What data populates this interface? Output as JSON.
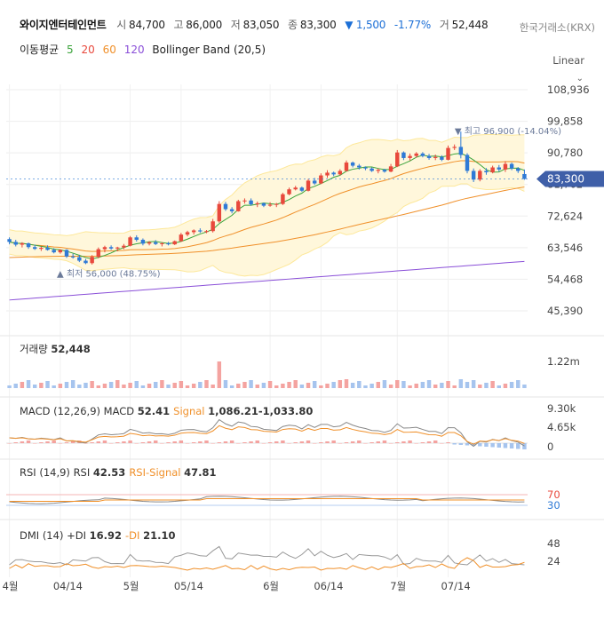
{
  "header": {
    "name": "와이지엔터테인먼트",
    "open_label": "시",
    "open": "84,700",
    "high_label": "고",
    "high": "86,000",
    "low_label": "저",
    "low": "83,050",
    "close_label": "종",
    "close": "83,300",
    "change": "▼ 1,500",
    "change_pct": "-1.77%",
    "volume_label": "거",
    "volume": "52,448",
    "exchange": "한국거래소(KRX)"
  },
  "indicators": {
    "ma_label": "이동평균",
    "ma": [
      {
        "p": "5",
        "color": "#3aa33a"
      },
      {
        "p": "20",
        "color": "#e8483c"
      },
      {
        "p": "60",
        "color": "#f0902a"
      },
      {
        "p": "120",
        "color": "#8a4fd8"
      }
    ],
    "bb_label": "Bollinger Band (20,5)",
    "scale": "Linear"
  },
  "colors": {
    "up": "#e8483c",
    "down": "#2f7ad6",
    "ma5": "#3aa33a",
    "ma20": "#e8483c",
    "ma60": "#f0902a",
    "ma120": "#8a4fd8",
    "bb": "#fde89a",
    "bbfill": "#fff7db"
  },
  "chart_data": {
    "type": "candlestick",
    "x_ticks": [
      "4월",
      "04/14",
      "5월",
      "05/14",
      "6월",
      "06/14",
      "7월",
      "07/14"
    ],
    "y_ticks": [
      108936,
      99858,
      90780,
      81702,
      72624,
      63546,
      54468,
      45390
    ],
    "ylim": [
      45390,
      108936
    ],
    "last_price_label": "83,300",
    "max_annot": "▼ 최고 96,900 (-14.04%)",
    "min_annot": "▲ 최저 56,000 (48.75%)",
    "candles": [
      [
        66000,
        66500,
        64500,
        65200
      ],
      [
        65200,
        65800,
        63900,
        64400
      ],
      [
        64400,
        65100,
        63600,
        64800
      ],
      [
        64800,
        65000,
        63200,
        63700
      ],
      [
        63700,
        64400,
        62900,
        63200
      ],
      [
        63200,
        63900,
        62600,
        63500
      ],
      [
        63500,
        64200,
        62700,
        62900
      ],
      [
        62900,
        63400,
        61900,
        62200
      ],
      [
        62200,
        63100,
        61800,
        62900
      ],
      [
        62900,
        63100,
        60600,
        61000
      ],
      [
        61000,
        61800,
        60400,
        60800
      ],
      [
        60800,
        61500,
        59400,
        59800
      ],
      [
        59800,
        60300,
        58800,
        59100
      ],
      [
        59100,
        61400,
        58700,
        60900
      ],
      [
        60900,
        63600,
        60500,
        63100
      ],
      [
        63100,
        64100,
        62200,
        63700
      ],
      [
        63700,
        64200,
        62900,
        63300
      ],
      [
        63300,
        63800,
        62500,
        63600
      ],
      [
        63600,
        64600,
        63100,
        64100
      ],
      [
        64100,
        66900,
        63900,
        66500
      ],
      [
        66500,
        67100,
        65300,
        65800
      ],
      [
        65800,
        66200,
        64200,
        64700
      ],
      [
        64700,
        65400,
        64200,
        65100
      ],
      [
        65100,
        65700,
        64300,
        64600
      ],
      [
        64600,
        65100,
        63900,
        64800
      ],
      [
        64800,
        65200,
        64200,
        64500
      ],
      [
        64500,
        65600,
        64300,
        65400
      ],
      [
        65400,
        67800,
        65200,
        67300
      ],
      [
        67300,
        68400,
        66800,
        68000
      ],
      [
        68000,
        68800,
        67300,
        68500
      ],
      [
        68500,
        69100,
        67800,
        68200
      ],
      [
        68200,
        68600,
        67700,
        68300
      ],
      [
        68300,
        71800,
        67900,
        71100
      ],
      [
        71100,
        76900,
        70700,
        76100
      ],
      [
        76100,
        76700,
        74100,
        74600
      ],
      [
        74600,
        75200,
        73400,
        74000
      ],
      [
        74000,
        77300,
        73900,
        76900
      ],
      [
        76900,
        77700,
        76200,
        77100
      ],
      [
        77100,
        77700,
        75600,
        76000
      ],
      [
        76000,
        76800,
        75200,
        76300
      ],
      [
        76300,
        76500,
        75200,
        75600
      ],
      [
        75600,
        76600,
        75300,
        75900
      ],
      [
        75900,
        76400,
        75200,
        76100
      ],
      [
        76100,
        79300,
        75800,
        78900
      ],
      [
        78900,
        80800,
        78600,
        80300
      ],
      [
        80300,
        81300,
        80000,
        80800
      ],
      [
        80800,
        81100,
        79600,
        79900
      ],
      [
        79900,
        83300,
        79700,
        82800
      ],
      [
        82800,
        83600,
        81600,
        82000
      ],
      [
        82000,
        84900,
        81800,
        84300
      ],
      [
        84300,
        85800,
        83600,
        85100
      ],
      [
        85100,
        85400,
        84100,
        84600
      ],
      [
        84600,
        86100,
        84300,
        85600
      ],
      [
        85600,
        88600,
        85400,
        88000
      ],
      [
        88000,
        88300,
        86600,
        87100
      ],
      [
        87100,
        87600,
        86000,
        86600
      ],
      [
        86600,
        86900,
        85800,
        86300
      ],
      [
        86300,
        86600,
        85300,
        85600
      ],
      [
        85600,
        86300,
        84900,
        85900
      ],
      [
        85900,
        86200,
        85100,
        85400
      ],
      [
        85400,
        87600,
        85200,
        86900
      ],
      [
        86900,
        91600,
        86700,
        90900
      ],
      [
        90900,
        91200,
        88700,
        89300
      ],
      [
        89300,
        90600,
        88600,
        89900
      ],
      [
        89900,
        91000,
        89400,
        90600
      ],
      [
        90600,
        91000,
        89500,
        89900
      ],
      [
        89900,
        90500,
        88800,
        89300
      ],
      [
        89300,
        90300,
        88700,
        89600
      ],
      [
        89600,
        90100,
        88400,
        88800
      ],
      [
        88800,
        92900,
        88600,
        92200
      ],
      [
        92200,
        93200,
        91600,
        92500
      ],
      [
        92500,
        96900,
        89200,
        90200
      ],
      [
        90200,
        90700,
        84900,
        85600
      ],
      [
        85600,
        86300,
        82400,
        83100
      ],
      [
        83100,
        86100,
        82600,
        85600
      ],
      [
        85600,
        86400,
        84500,
        85200
      ],
      [
        85200,
        87100,
        84900,
        86600
      ],
      [
        86600,
        87300,
        85400,
        86000
      ],
      [
        86000,
        88400,
        85300,
        87600
      ],
      [
        87600,
        88000,
        85800,
        86300
      ],
      [
        86300,
        86700,
        85000,
        85600
      ],
      [
        84700,
        86000,
        83050,
        83300
      ]
    ],
    "volume": {
      "label": "거래량",
      "value": "52,448",
      "ytick": "1.22m"
    },
    "macd": {
      "label": "MACD (12,26,9)",
      "name": "MACD",
      "value": "52.41",
      "signal_name": "Signal",
      "signal": "1,086.21",
      "hist": "-1,033.80",
      "yticks": [
        "9.30k",
        "4.65k",
        "0"
      ]
    },
    "rsi": {
      "label": "RSI (14,9)",
      "name": "RSI",
      "value": "42.53",
      "signal_name": "RSI-Signal",
      "signal": "47.81",
      "yticks": [
        "70",
        "30"
      ]
    },
    "dmi": {
      "label": "DMI (14)",
      "pdi_name": "+DI",
      "pdi": "16.92",
      "mdi_name": "-DI",
      "mdi": "21.10",
      "yticks": [
        "48",
        "24"
      ]
    }
  }
}
